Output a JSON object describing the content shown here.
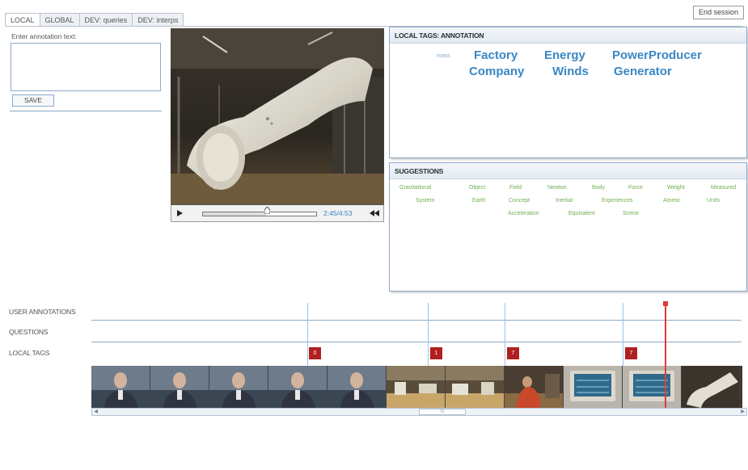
{
  "tabs": [
    {
      "label": "LOCAL",
      "active": true
    },
    {
      "label": "GLOBAL",
      "active": false
    },
    {
      "label": "DEV: queries",
      "active": false
    },
    {
      "label": "DEV: interps",
      "active": false
    }
  ],
  "header": {
    "end_session_label": "End session"
  },
  "annotation": {
    "label": "Enter annotation text:",
    "value": "",
    "save_label": "SAVE"
  },
  "video": {
    "time": "2:45/4:53",
    "progress": 0.56,
    "icons": {
      "play": "play-icon",
      "rewind": "rewind-icon"
    }
  },
  "local_tags": {
    "title": "LOCAL TAGS: ANNOTATION",
    "tags": [
      "mass",
      "Factory",
      "Energy",
      "PowerProducer",
      "Company",
      "Winds",
      "Generator"
    ]
  },
  "suggestions": {
    "title": "SUGGESTIONS",
    "items": [
      "Gravitational",
      "Object",
      "Field",
      "Newton",
      "Body",
      "Force",
      "Weight",
      "Measured",
      "System",
      "Earth",
      "Concept",
      "Inertial",
      "Experiences",
      "Atomic",
      "Units",
      "Acceleration",
      "Equivalent",
      "Scene"
    ]
  },
  "timeline": {
    "tracks": [
      "USER ANNOTATIONS",
      "QUESTIONS",
      "LOCAL TAGS"
    ],
    "tag_markers": [
      "0",
      "1",
      "7",
      "7"
    ],
    "scroll_thumb_label": "III"
  },
  "colors": {
    "tag_blue": "#3a87c4",
    "suggestion_green": "#6fae4f",
    "marker_red": "#b02020",
    "playhead": "#e03a3a"
  }
}
